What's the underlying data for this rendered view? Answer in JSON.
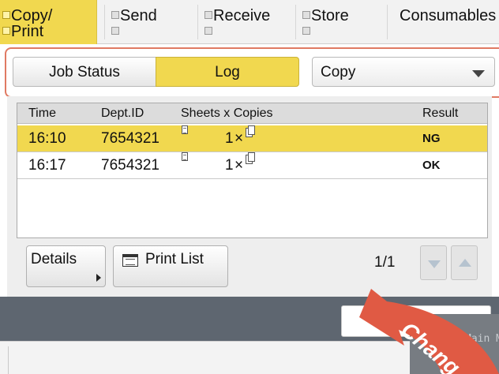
{
  "tabs": [
    {
      "line1": "Copy/",
      "line2": "Print",
      "active": true
    },
    {
      "line1": "Send",
      "line2": "",
      "active": false
    },
    {
      "line1": "Receive",
      "line2": "",
      "active": false
    },
    {
      "line1": "Store",
      "line2": "",
      "active": false
    },
    {
      "line1": "Consumables",
      "line2": "",
      "active": false
    }
  ],
  "toolbar": {
    "job_status_label": "Job Status",
    "log_label": "Log",
    "mode_selected": "Copy"
  },
  "log": {
    "headers": {
      "time": "Time",
      "dept": "Dept.ID",
      "sheets": "Sheets x Copies",
      "result": "Result"
    },
    "rows": [
      {
        "time": "16:10",
        "dept": "7654321",
        "sheets": "1",
        "mult": "×",
        "result": "NG",
        "selected": true
      },
      {
        "time": "16:17",
        "dept": "7654321",
        "sheets": "1",
        "mult": "×",
        "result": "OK",
        "selected": false
      }
    ]
  },
  "buttons": {
    "details_label": "Details",
    "print_list_label": "Print List"
  },
  "pager": {
    "text": "1/1"
  },
  "main_menu": {
    "label": "Main Menu"
  },
  "callout": {
    "text": "Chang",
    "color": "#e05a44"
  },
  "colors": {
    "accent_yellow": "#f1d84f",
    "highlight_frame": "#e07a63",
    "dark_band": "#5e6670"
  },
  "icons": [
    "document-icon",
    "copies-stack-icon",
    "print-list-icon",
    "caret-down-icon",
    "page-up-icon",
    "page-down-icon",
    "submenu-arrow-icon"
  ]
}
